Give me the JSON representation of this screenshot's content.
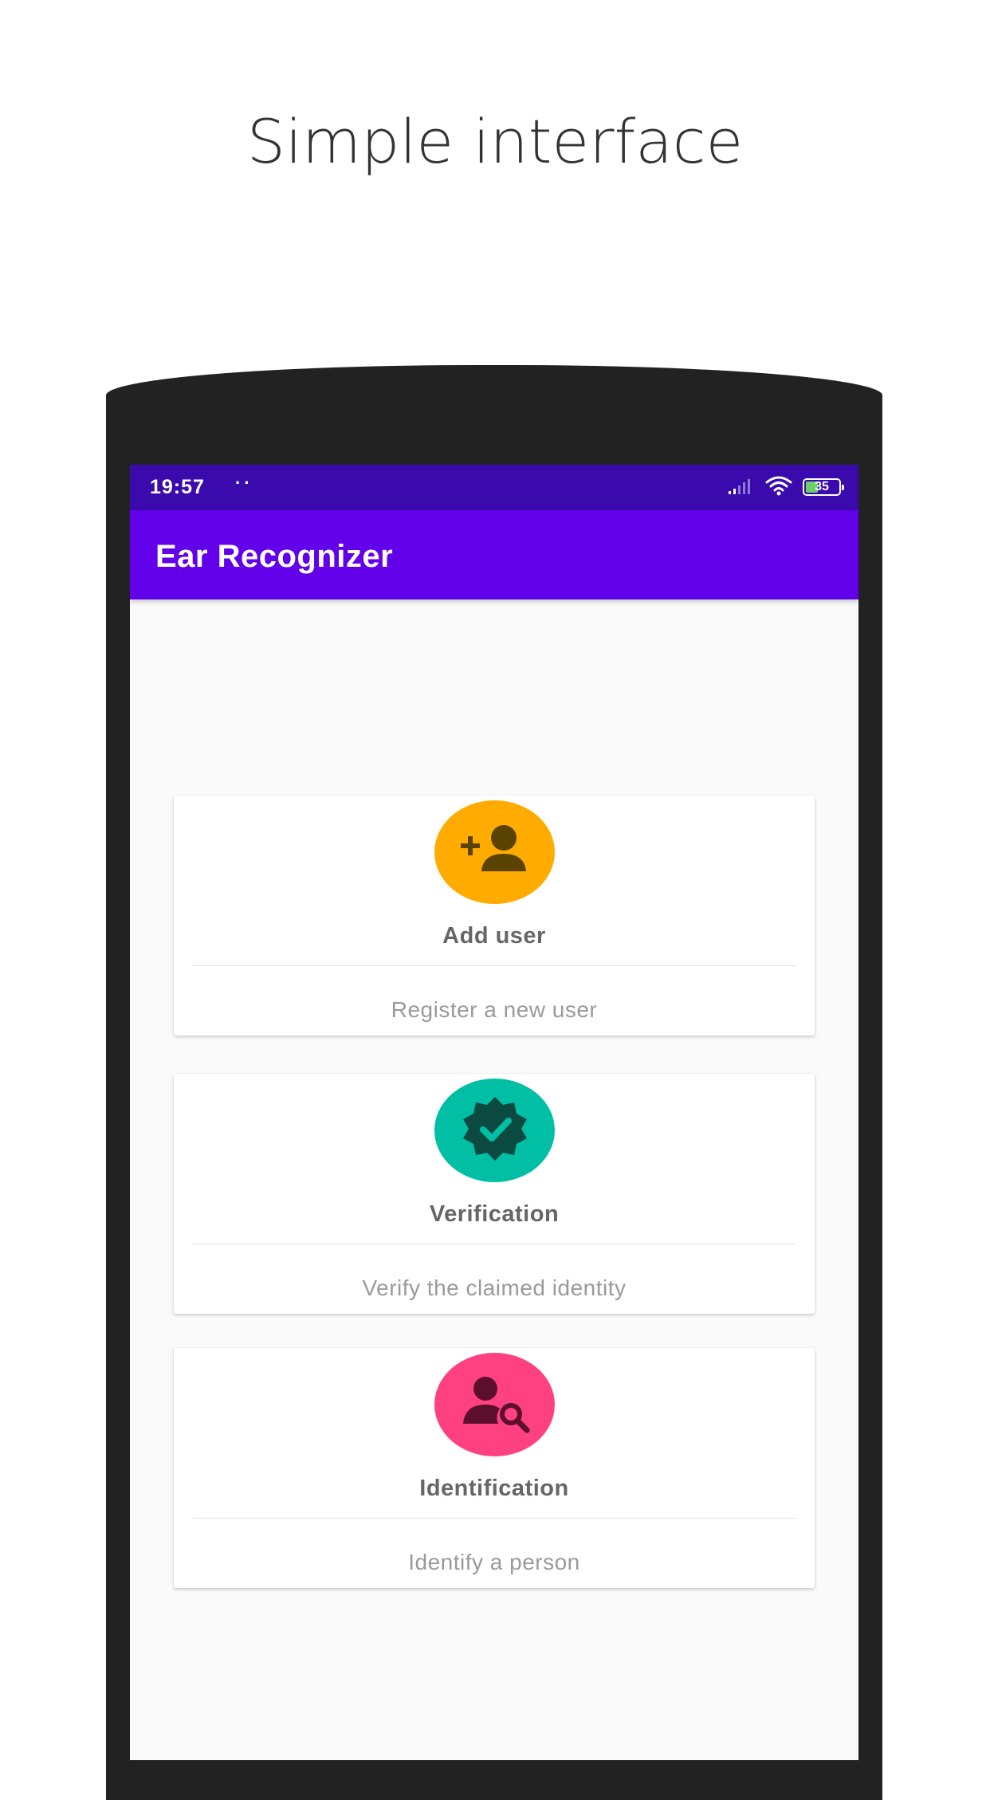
{
  "promo": {
    "heading": "Simple interface"
  },
  "status_bar": {
    "time": "19:57",
    "notification_dots": "··",
    "battery_level": "35",
    "icons": [
      "signal-icon",
      "wifi-icon",
      "battery-icon"
    ]
  },
  "app_bar": {
    "title": "Ear Recognizer"
  },
  "cards": [
    {
      "icon": "add-user-icon",
      "icon_color": "#ffab00",
      "title": "Add user",
      "subtitle": "Register a new user"
    },
    {
      "icon": "verified-badge-icon",
      "icon_color": "#00bfa5",
      "title": "Verification",
      "subtitle": "Verify the claimed identity"
    },
    {
      "icon": "person-search-icon",
      "icon_color": "#ff4081",
      "title": "Identification",
      "subtitle": "Identify a person"
    }
  ],
  "colors": {
    "status_bar": "#3a0aad",
    "app_bar": "#6200ea",
    "screen_background": "#fafafa",
    "phone_frame": "#222222"
  }
}
